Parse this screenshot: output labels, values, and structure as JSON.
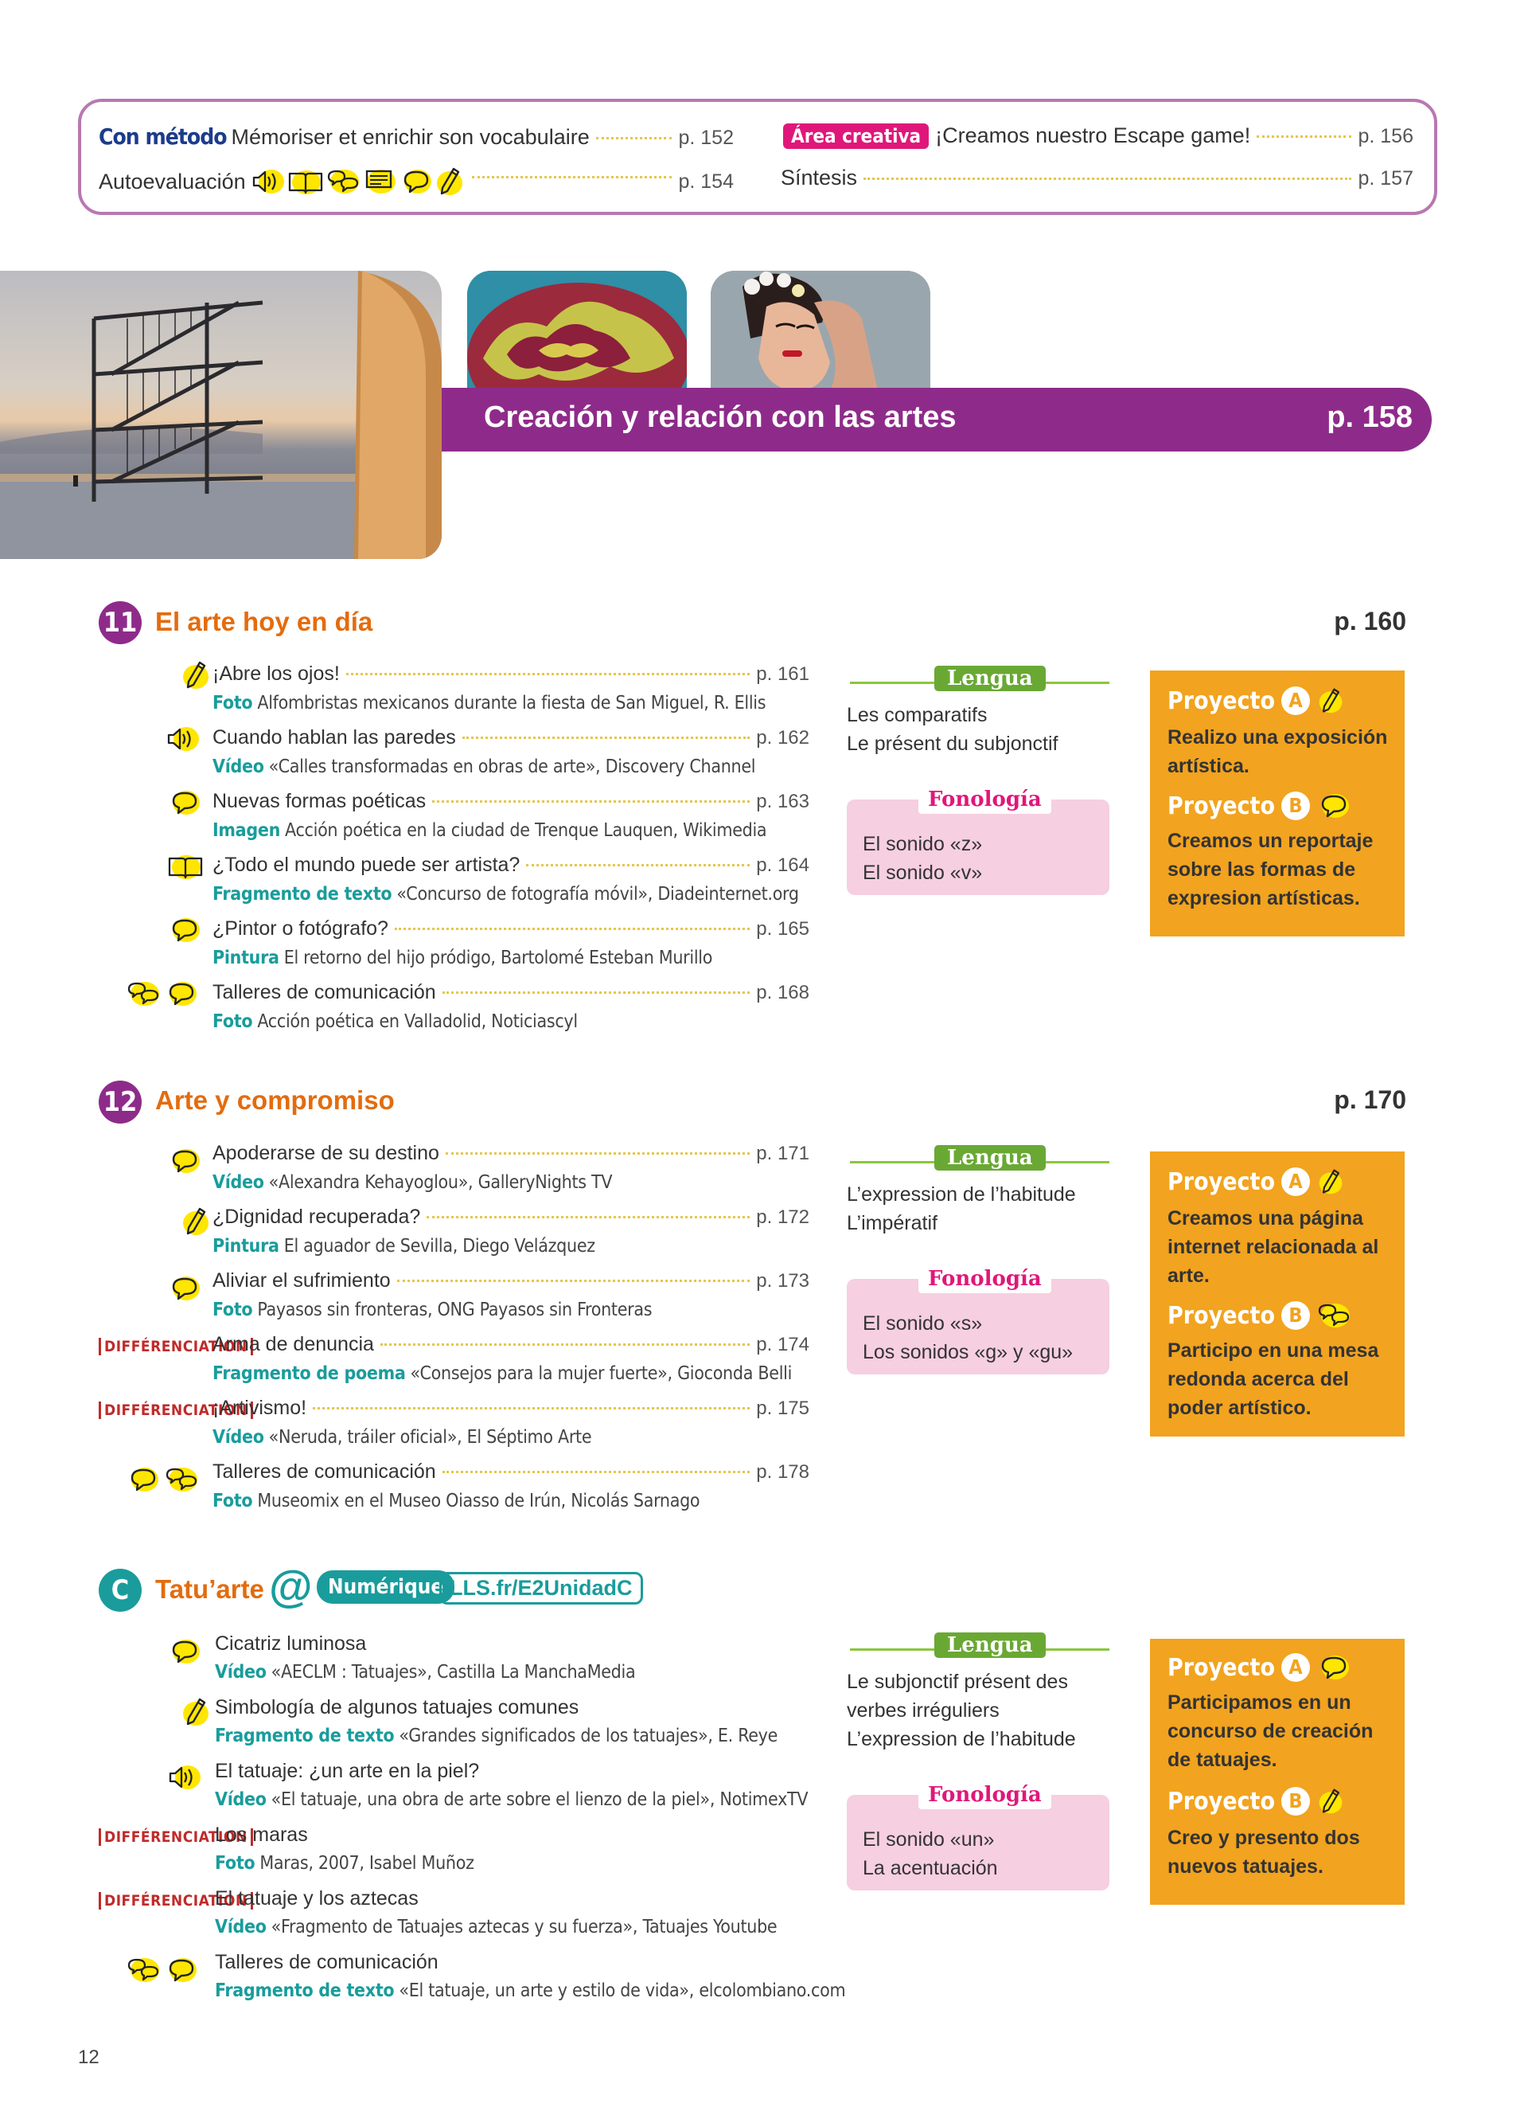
{
  "top": {
    "con_metodo": "Con método",
    "memoriser": "Mémoriser et enrichir son vocabulaire",
    "memoriser_pg": "p. 152",
    "area_tag": "Área creativa",
    "escape": "¡Creamos nuestro Escape game!",
    "escape_pg": "p. 156",
    "autoevaluacion": "Autoevaluación",
    "autoevaluacion_pg": "p. 154",
    "sintesis": "Síntesis",
    "sintesis_pg": "p. 157"
  },
  "banner": {
    "title": "Creación y relación con las artes",
    "page": "p. 158"
  },
  "unit11": {
    "num": "11",
    "title": "El arte hoy en día",
    "page": "p. 160",
    "items": [
      {
        "title": "¡Abre los ojos!",
        "page": "p. 161",
        "kw": "Foto",
        "desc": "Alfombristas mexicanos durante la fiesta de San Miguel, R. Ellis"
      },
      {
        "title": "Cuando hablan las paredes",
        "page": "p. 162",
        "kw": "Vídeo",
        "desc": "«Calles transformadas en obras de arte», Discovery Channel"
      },
      {
        "title": "Nuevas formas poéticas",
        "page": "p. 163",
        "kw": "Imagen",
        "desc": "Acción poética en la ciudad de Trenque Lauquen, Wikimedia"
      },
      {
        "title": "¿Todo el mundo puede ser artista?",
        "page": "p. 164",
        "kw": "Fragmento de texto",
        "desc": "«Concurso de fotografía móvil», Diadeinternet.org"
      },
      {
        "title": "¿Pintor o fotógrafo?",
        "page": "p. 165",
        "kw": "Pintura",
        "desc": "El retorno del hijo pródigo, Bartolomé Esteban Murillo"
      },
      {
        "title": "Talleres de comunicación",
        "page": "p. 168",
        "kw": "Foto",
        "desc": "Acción poética en Valladolid, Noticiascyl"
      }
    ],
    "lengua_label": "Lengua",
    "lengua": [
      "Les comparatifs",
      "Le présent du subjonctif"
    ],
    "fono_label": "Fonología",
    "fono": [
      "El sonido «z»",
      "El sonido «v»"
    ],
    "proyecto_label": "Proyecto",
    "projA_letter": "A",
    "projA": "Realizo una exposición artística.",
    "projB_letter": "B",
    "projB": "Creamos un reportaje sobre las formas de expresion artísticas."
  },
  "unit12": {
    "num": "12",
    "title": "Arte y compromiso",
    "page": "p. 170",
    "items": [
      {
        "title": "Apoderarse de su destino",
        "page": "p. 171",
        "kw": "Vídeo",
        "desc": "«Alexandra Kehayoglou», GalleryNights TV"
      },
      {
        "title": "¿Dignidad recuperada?",
        "page": "p. 172",
        "kw": "Pintura",
        "desc": "El aguador de Sevilla, Diego Velázquez"
      },
      {
        "title": "Aliviar el sufrimiento",
        "page": "p. 173",
        "kw": "Foto",
        "desc": "Payasos sin fronteras, ONG Payasos sin Fronteras"
      },
      {
        "title": "Arma de denuncia",
        "page": "p. 174",
        "kw": "Fragmento de poema",
        "desc": "«Consejos para la mujer fuerte», Gioconda Belli"
      },
      {
        "title": "¡Artivismo!",
        "page": "p. 175",
        "kw": "Vídeo",
        "desc": "«Neruda, tráiler oficial», El Séptimo Arte"
      },
      {
        "title": "Talleres de comunicación",
        "page": "p. 178",
        "kw": "Foto",
        "desc": "Museomix en el Museo Oiasso de Irún, Nicolás Sarnago"
      }
    ],
    "differenciation": "DIFFÉRENCIATION",
    "lengua_label": "Lengua",
    "lengua": [
      "L’expression de l’habitude",
      "L’impératif"
    ],
    "fono_label": "Fonología",
    "fono": [
      "El sonido «s»",
      "Los sonidos «g» y «gu»"
    ],
    "proyecto_label": "Proyecto",
    "projA_letter": "A",
    "projA": "Creamos una página internet relacionada al arte.",
    "projB_letter": "B",
    "projB": "Participo en una mesa redonda acerca del poder artístico."
  },
  "unitC": {
    "num": "C",
    "title": "Tatu’arte",
    "at": "@",
    "numerique": "Numérique",
    "link": "LLS.fr/E2UnidadC",
    "items": [
      {
        "title": "Cicatriz luminosa",
        "kw": "Vídeo",
        "desc": "«AECLM : Tatuajes», Castilla La ManchaMedia"
      },
      {
        "title": "Simbología de algunos tatuajes comunes",
        "kw": "Fragmento de texto",
        "desc": "«Grandes significados de los tatuajes», E. Reye"
      },
      {
        "title": "El tatuaje: ¿un arte en la piel?",
        "kw": "Vídeo",
        "desc": "«El tatuaje, una obra de arte sobre el lienzo de la piel», NotimexTV"
      },
      {
        "title": "Los maras",
        "kw": "Foto",
        "desc": "Maras, 2007, Isabel Muñoz"
      },
      {
        "title": "El tatuaje y los aztecas",
        "kw": "Vídeo",
        "desc": "«Fragmento de Tatuajes aztecas y su fuerza», Tatuajes Youtube"
      },
      {
        "title": "Talleres de comunicación",
        "kw": "Fragmento de texto",
        "desc": "«El tatuaje, un arte y estilo de vida», elcolombiano.com"
      }
    ],
    "lengua_label": "Lengua",
    "lengua": [
      "Le subjonctif présent des",
      "verbes irréguliers",
      "L’expression de l’habitude"
    ],
    "fono_label": "Fonología",
    "fono": [
      "El sonido «un»",
      "La acentuación"
    ],
    "proyecto_label": "Proyecto",
    "projA_letter": "A",
    "projA": "Participamos en un concurso de creación de tatuajes.",
    "projB_letter": "B",
    "projB": "Creo y presento dos nuevos tatuajes."
  },
  "page_number": "12"
}
